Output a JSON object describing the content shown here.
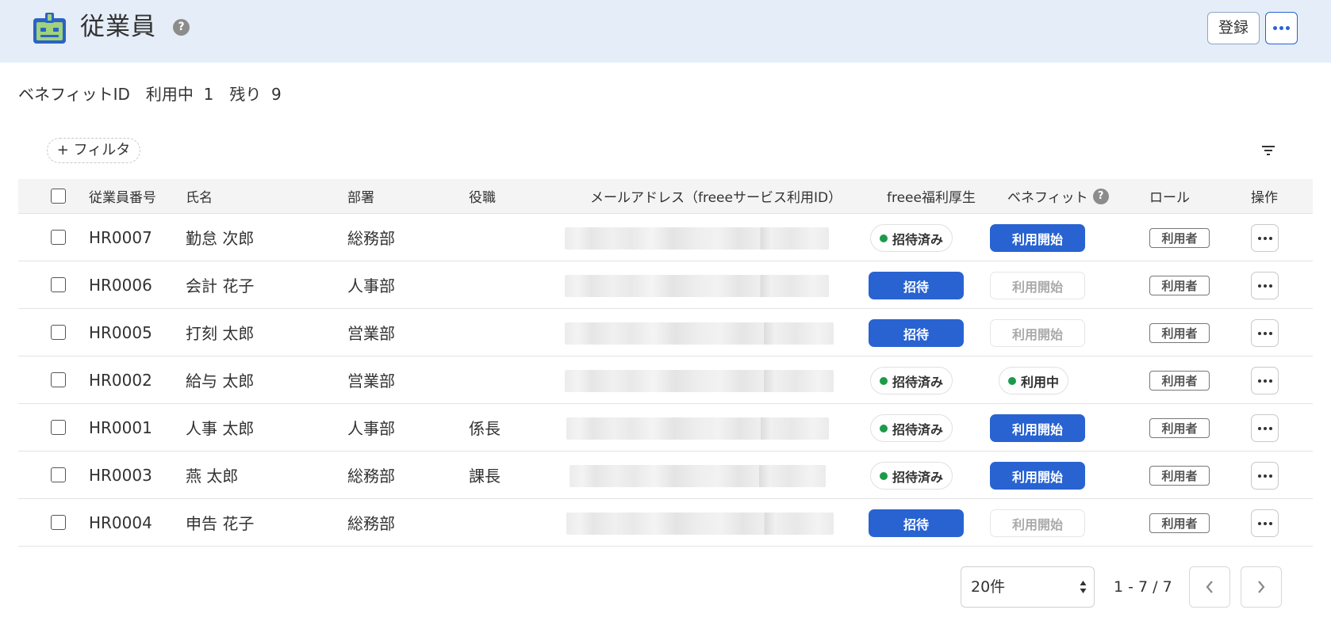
{
  "header": {
    "title": "従業員",
    "help": "?",
    "register_label": "登録"
  },
  "benefit_summary": "ベネフィットID　利用中  1　残り  9",
  "filter_label": "+ フィルタ",
  "table": {
    "headers": {
      "employee_number": "従業員番号",
      "name": "氏名",
      "department": "部署",
      "position": "役職",
      "email": "メールアドレス（freeeサービス利用ID）",
      "welfare": "freee福利厚生",
      "benefit": "ベネフィット",
      "role": "ロール",
      "actions": "操作"
    },
    "rows": [
      {
        "employee_number": "HR0007",
        "name": "勤怠 次郎",
        "department": "総務部",
        "position": "",
        "welfare": "招待済み",
        "welfare_state": "invited",
        "benefit": "利用開始",
        "benefit_state": "button",
        "role": "利用者"
      },
      {
        "employee_number": "HR0006",
        "name": "会計 花子",
        "department": "人事部",
        "position": "",
        "welfare": "招待",
        "welfare_state": "button",
        "benefit": "利用開始",
        "benefit_state": "disabled",
        "role": "利用者"
      },
      {
        "employee_number": "HR0005",
        "name": "打刻 太郎",
        "department": "営業部",
        "position": "",
        "welfare": "招待",
        "welfare_state": "button",
        "benefit": "利用開始",
        "benefit_state": "disabled",
        "role": "利用者"
      },
      {
        "employee_number": "HR0002",
        "name": "給与 太郎",
        "department": "営業部",
        "position": "",
        "welfare": "招待済み",
        "welfare_state": "invited",
        "benefit": "利用中",
        "benefit_state": "active",
        "role": "利用者"
      },
      {
        "employee_number": "HR0001",
        "name": "人事 太郎",
        "department": "人事部",
        "position": "係長",
        "welfare": "招待済み",
        "welfare_state": "invited",
        "benefit": "利用開始",
        "benefit_state": "button",
        "role": "利用者"
      },
      {
        "employee_number": "HR0003",
        "name": "燕 太郎",
        "department": "総務部",
        "position": "課長",
        "welfare": "招待済み",
        "welfare_state": "invited",
        "benefit": "利用開始",
        "benefit_state": "button",
        "role": "利用者"
      },
      {
        "employee_number": "HR0004",
        "name": "申告 花子",
        "department": "総務部",
        "position": "",
        "welfare": "招待",
        "welfare_state": "button",
        "benefit": "利用開始",
        "benefit_state": "disabled",
        "role": "利用者"
      }
    ]
  },
  "pagination": {
    "per_page": "20件",
    "range": "1 - 7 / 7"
  },
  "colors": {
    "header_bg": "#e5edf8",
    "primary": "#2863d1",
    "status_green": "#1b9a4b"
  }
}
